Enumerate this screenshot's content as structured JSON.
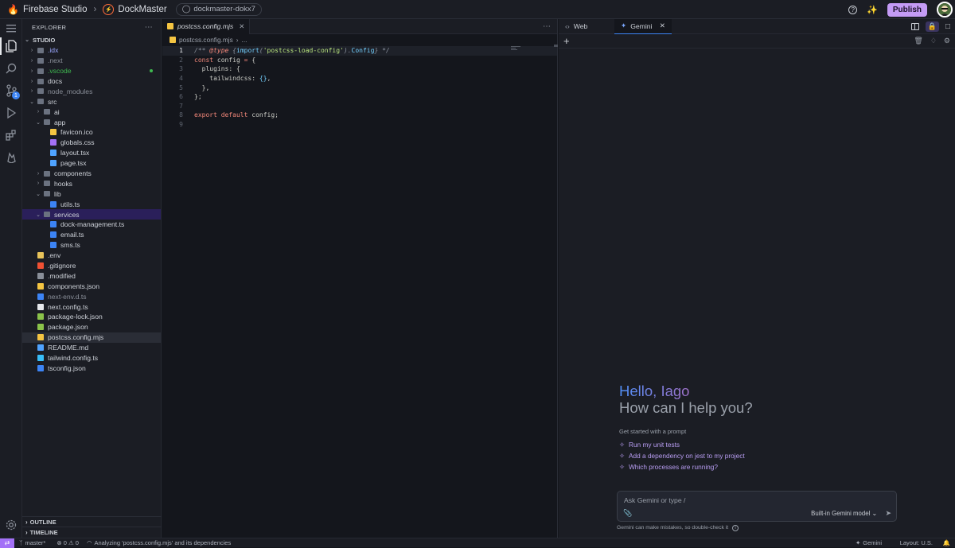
{
  "topbar": {
    "app_name": "Firebase Studio",
    "project_name": "DockMaster",
    "workspace_chip": "dockmaster-dokx7",
    "publish_label": "Publish"
  },
  "explorer": {
    "title": "EXPLORER",
    "root": "STUDIO",
    "items": [
      {
        "label": ".idx",
        "depth": 0,
        "type": "folder",
        "open": false,
        "color": "#9aa7ff"
      },
      {
        "label": ".next",
        "depth": 0,
        "type": "folder",
        "open": false,
        "color": "#8a8f99"
      },
      {
        "label": ".vscode",
        "depth": 0,
        "type": "folder",
        "open": false,
        "color": "#3fb950"
      },
      {
        "label": "docs",
        "depth": 0,
        "type": "folder",
        "open": false,
        "color": "#cdd1d8"
      },
      {
        "label": "node_modules",
        "depth": 0,
        "type": "folder",
        "open": false,
        "color": "#8a8f99"
      },
      {
        "label": "src",
        "depth": 0,
        "type": "folder",
        "open": true,
        "color": "#cdd1d8"
      },
      {
        "label": "ai",
        "depth": 1,
        "type": "folder",
        "open": false,
        "color": "#cdd1d8"
      },
      {
        "label": "app",
        "depth": 1,
        "type": "folder",
        "open": true,
        "color": "#cdd1d8"
      },
      {
        "label": "favicon.ico",
        "depth": 2,
        "type": "file",
        "color": "#cdd1d8",
        "icon": "#f5c542"
      },
      {
        "label": "globals.css",
        "depth": 2,
        "type": "file",
        "color": "#cdd1d8",
        "icon": "#a371f7"
      },
      {
        "label": "layout.tsx",
        "depth": 2,
        "type": "file",
        "color": "#cdd1d8",
        "icon": "#4fa3ff"
      },
      {
        "label": "page.tsx",
        "depth": 2,
        "type": "file",
        "color": "#cdd1d8",
        "icon": "#4fa3ff"
      },
      {
        "label": "components",
        "depth": 1,
        "type": "folder",
        "open": false,
        "color": "#cdd1d8"
      },
      {
        "label": "hooks",
        "depth": 1,
        "type": "folder",
        "open": false,
        "color": "#cdd1d8"
      },
      {
        "label": "lib",
        "depth": 1,
        "type": "folder",
        "open": true,
        "color": "#cdd1d8"
      },
      {
        "label": "utils.ts",
        "depth": 2,
        "type": "file",
        "color": "#cdd1d8",
        "icon": "#3c84f5"
      },
      {
        "label": "services",
        "depth": 1,
        "type": "folder",
        "open": true,
        "color": "#cdd1d8",
        "selected": true
      },
      {
        "label": "dock-management.ts",
        "depth": 2,
        "type": "file",
        "color": "#cdd1d8",
        "icon": "#3c84f5"
      },
      {
        "label": "email.ts",
        "depth": 2,
        "type": "file",
        "color": "#cdd1d8",
        "icon": "#3c84f5"
      },
      {
        "label": "sms.ts",
        "depth": 2,
        "type": "file",
        "color": "#cdd1d8",
        "icon": "#3c84f5"
      },
      {
        "label": ".env",
        "depth": 0,
        "type": "file",
        "color": "#cdd1d8",
        "icon": "#e8c35a"
      },
      {
        "label": ".gitignore",
        "depth": 0,
        "type": "file",
        "color": "#cdd1d8",
        "icon": "#f05133"
      },
      {
        "label": ".modified",
        "depth": 0,
        "type": "file",
        "color": "#cdd1d8",
        "icon": "#8a8f99"
      },
      {
        "label": "components.json",
        "depth": 0,
        "type": "file",
        "color": "#cdd1d8",
        "icon": "#f5c542"
      },
      {
        "label": "next-env.d.ts",
        "depth": 0,
        "type": "file",
        "color": "#8a8f99",
        "icon": "#3c84f5"
      },
      {
        "label": "next.config.ts",
        "depth": 0,
        "type": "file",
        "color": "#cdd1d8",
        "icon": "#e6e8ec"
      },
      {
        "label": "package-lock.json",
        "depth": 0,
        "type": "file",
        "color": "#cdd1d8",
        "icon": "#8bc34a"
      },
      {
        "label": "package.json",
        "depth": 0,
        "type": "file",
        "color": "#cdd1d8",
        "icon": "#8bc34a"
      },
      {
        "label": "postcss.config.mjs",
        "depth": 0,
        "type": "file",
        "color": "#cdd1d8",
        "icon": "#f5c542",
        "highlighted": true
      },
      {
        "label": "README.md",
        "depth": 0,
        "type": "file",
        "color": "#cdd1d8",
        "icon": "#4fa3ff"
      },
      {
        "label": "tailwind.config.ts",
        "depth": 0,
        "type": "file",
        "color": "#cdd1d8",
        "icon": "#38bdf8"
      },
      {
        "label": "tsconfig.json",
        "depth": 0,
        "type": "file",
        "color": "#cdd1d8",
        "icon": "#3c84f5"
      }
    ],
    "outline_label": "OUTLINE",
    "timeline_label": "TIMELINE"
  },
  "editor": {
    "tab_label": "postcss.config.mjs",
    "breadcrumb_file": "postcss.config.mjs",
    "breadcrumb_more": "...",
    "current_line": 1
  },
  "right_panel": {
    "tab_web": "Web",
    "tab_gemini": "Gemini",
    "greeting": "Hello, Iago",
    "subgreeting": "How can I help you?",
    "get_started": "Get started with a prompt",
    "suggestions": [
      "Run my unit tests",
      "Add a dependency on jest to my project",
      "Which processes are running?"
    ],
    "input_placeholder": "Ask Gemini or type /",
    "model_label": "Built-in Gemini model",
    "disclaimer": "Gemini can make mistakes, so double-check it"
  },
  "status_bar": {
    "branch": "master*",
    "problems": "⊗ 0 ⚠ 0",
    "analyzing": "Analyzing 'postcss.config.mjs' and its dependencies",
    "gemini": "Gemini",
    "layout": "Layout: U.S."
  },
  "colors": {
    "accent": "#c49bf5",
    "selection": "#2a1f5a",
    "status_remote": "#a371f7"
  }
}
